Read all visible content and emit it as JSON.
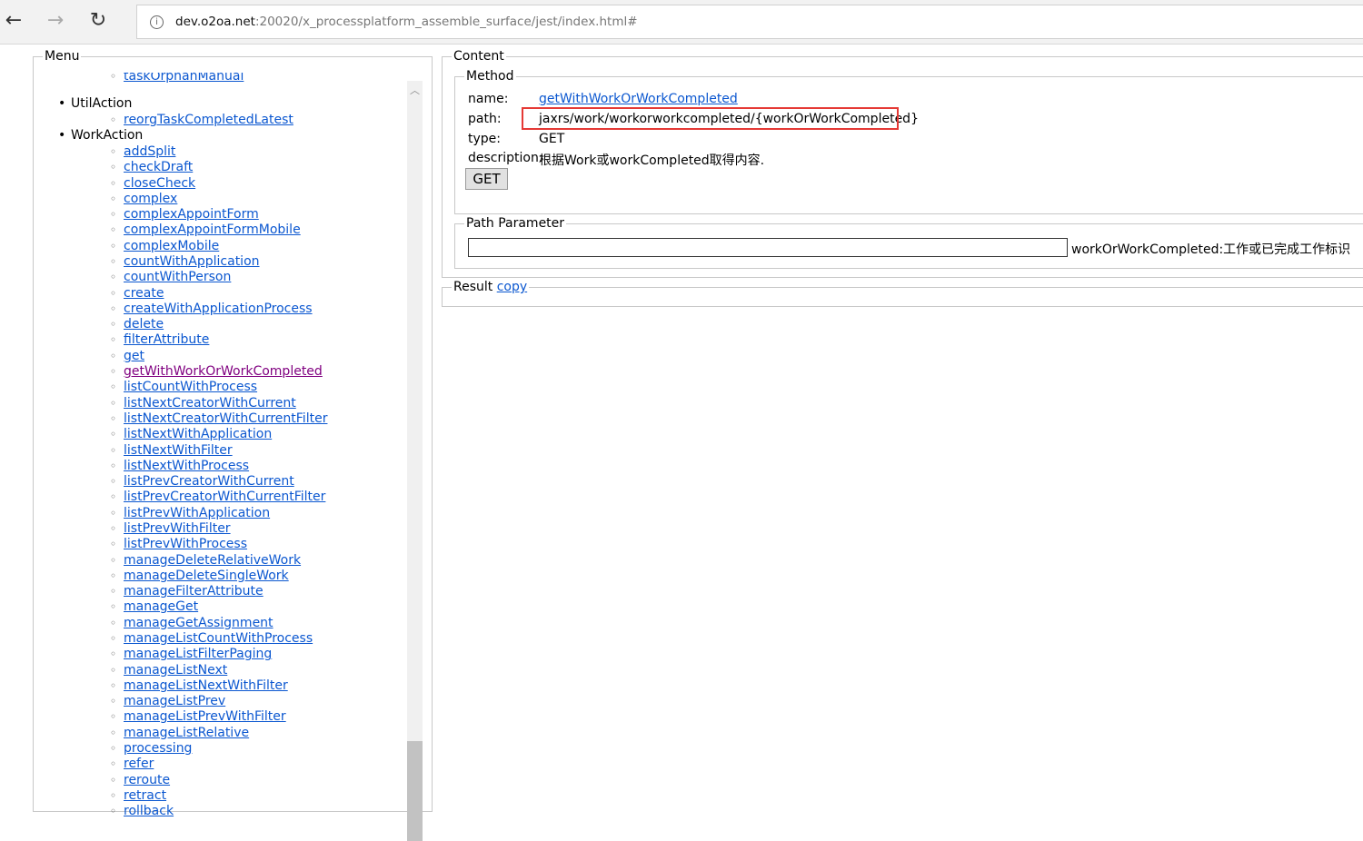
{
  "browser": {
    "url_host": "dev.o2oa.net",
    "url_rest": ":20020/x_processplatform_assemble_surface/jest/index.html#",
    "back": "←",
    "forward": "→",
    "reload": "↻"
  },
  "menu": {
    "legend": "Menu",
    "partial_item": "taskOrphanManual",
    "groups": [
      {
        "label": "UtilAction",
        "items": [
          "reorgTaskCompletedLatest"
        ]
      },
      {
        "label": "WorkAction"
      }
    ],
    "work_items": [
      "addSplit",
      "checkDraft",
      "closeCheck",
      "complex",
      "complexAppointForm",
      "complexAppointFormMobile",
      "complexMobile",
      "countWithApplication",
      "countWithPerson",
      "create",
      "createWithApplicationProcess",
      "delete",
      "filterAttribute",
      "get",
      "getWithWorkOrWorkCompleted",
      "listCountWithProcess",
      "listNextCreatorWithCurrent",
      "listNextCreatorWithCurrentFilter",
      "listNextWithApplication",
      "listNextWithFilter",
      "listNextWithProcess",
      "listPrevCreatorWithCurrent",
      "listPrevCreatorWithCurrentFilter",
      "listPrevWithApplication",
      "listPrevWithFilter",
      "listPrevWithProcess",
      "manageDeleteRelativeWork",
      "manageDeleteSingleWork",
      "manageFilterAttribute",
      "manageGet",
      "manageGetAssignment",
      "manageListCountWithProcess",
      "manageListFilterPaging",
      "manageListNext",
      "manageListNextWithFilter",
      "manageListPrev",
      "manageListPrevWithFilter",
      "manageListRelative",
      "processing",
      "refer",
      "reroute",
      "retract",
      "rollback"
    ],
    "visited": "getWithWorkOrWorkCompleted"
  },
  "content": {
    "legend": "Content",
    "method": {
      "legend": "Method",
      "name_label": "name:",
      "name": "getWithWorkOrWorkCompleted",
      "path_label": "path:",
      "path": "jaxrs/work/workorworkcompleted/{workOrWorkCompleted}",
      "type_label": "type:",
      "type": "GET",
      "description_label": "description:",
      "description": "根据Work或workCompleted取得内容.",
      "button": "GET"
    },
    "path_parameter": {
      "legend": "Path Parameter",
      "value": "",
      "label": "workOrWorkCompleted:工作或已完成工作标识"
    },
    "result": {
      "legend": "Result",
      "copy": "copy"
    }
  }
}
